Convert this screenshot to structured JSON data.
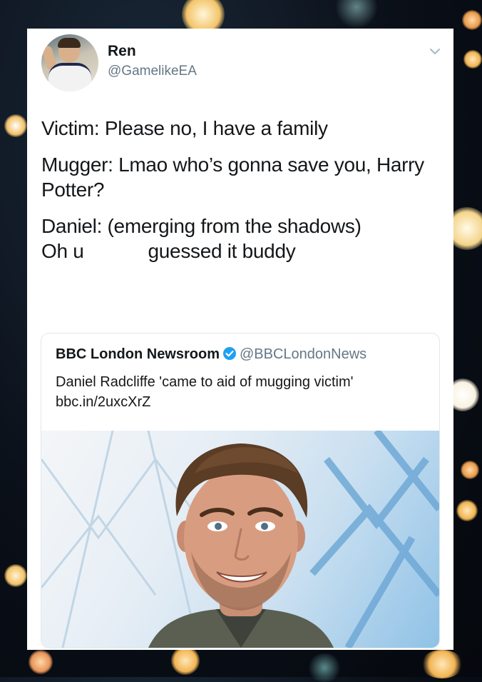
{
  "tweet": {
    "author_name": "Ren",
    "author_handle": "@GamelikeEA",
    "lines": [
      "Victim: Please no, I have a family",
      "Mugger: Lmao who’s gonna save you, Harry Potter?",
      "Daniel: (emerging from the shadows)"
    ],
    "last_line_start": "Oh u",
    "last_line_end": "guessed it buddy"
  },
  "quoted_tweet": {
    "author_name": "BBC London Newsroom",
    "author_handle": "@BBCLondonNews",
    "text": "Daniel Radcliffe 'came to aid of mugging victim' bbc.in/2uxcXrZ"
  },
  "icons": {
    "menu": "chevron-down-icon",
    "verified": "verified-badge-icon"
  },
  "colors": {
    "verified_blue": "#1da1f2",
    "handle_gray": "#657786",
    "text_dark": "#14171a"
  }
}
